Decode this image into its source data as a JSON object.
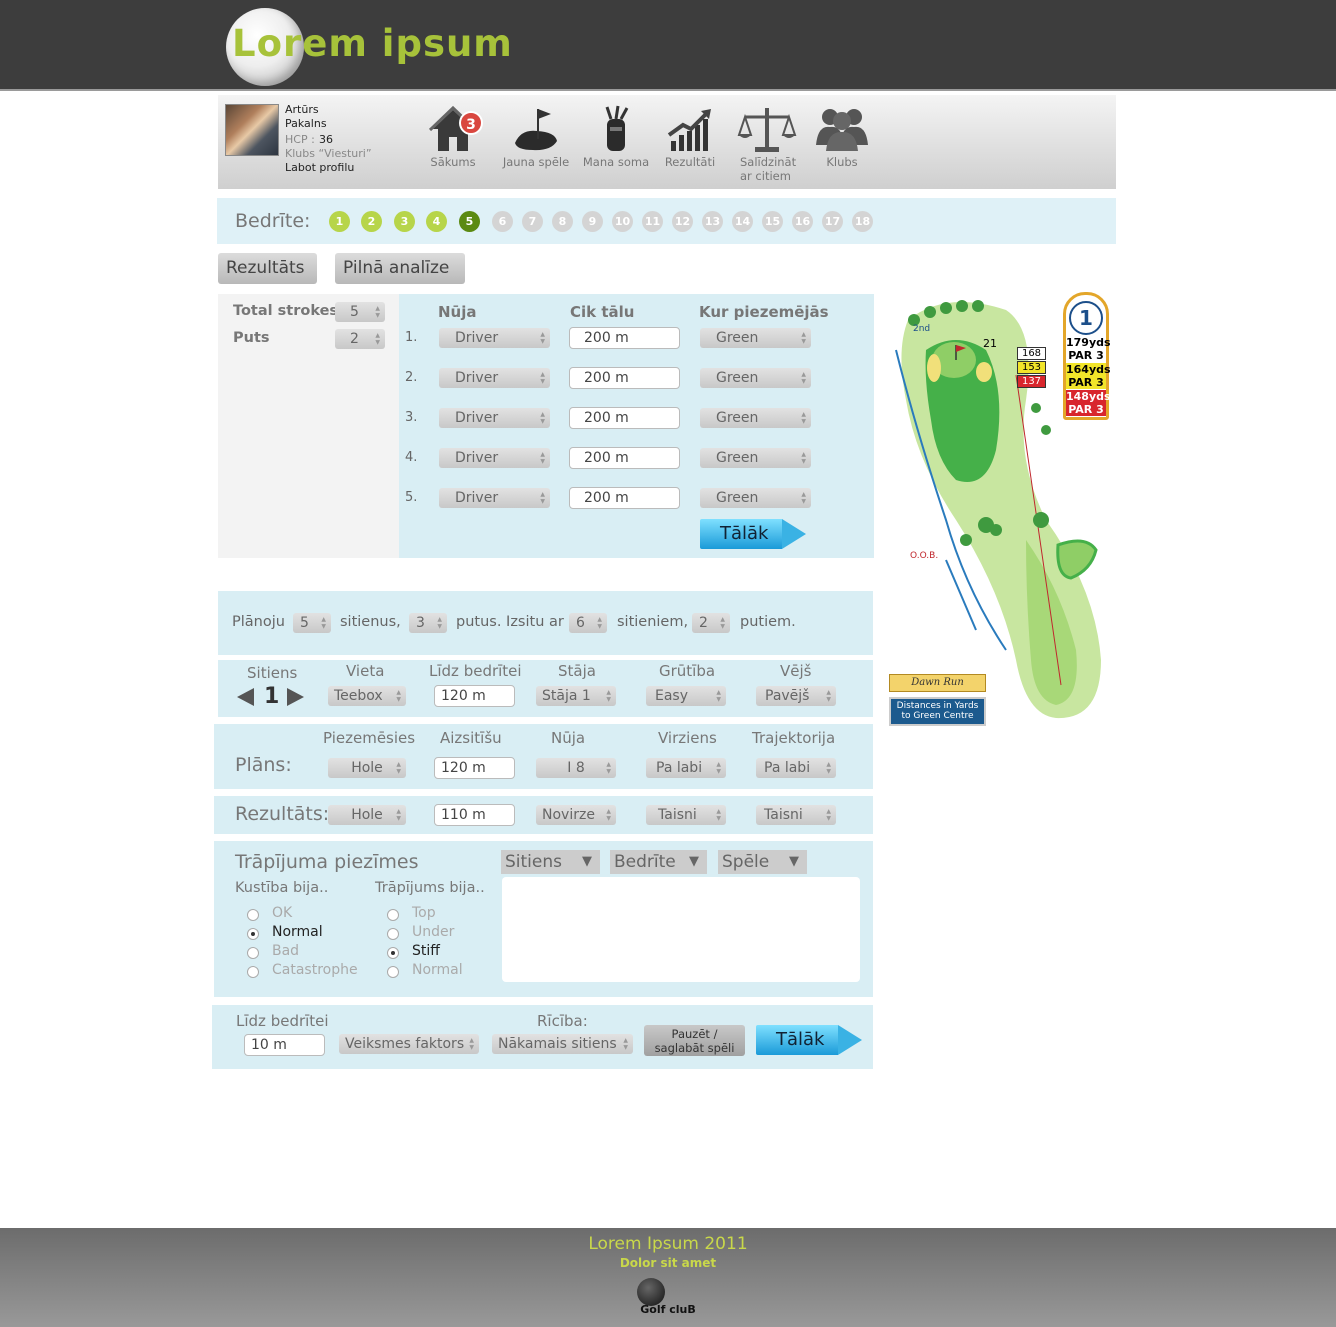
{
  "header": {
    "logo": "Lorem ipsum"
  },
  "user": {
    "first_name": "Artūrs",
    "last_name": "Pakalns",
    "hcp_label": "HCP :",
    "hcp_value": "36",
    "club": "Klubs “Viesturi”",
    "edit_profile": "Labot profilu"
  },
  "nav": {
    "badge": "3",
    "items": [
      {
        "label": "Sākums",
        "icon": "home-icon"
      },
      {
        "label": "Jauna spēle",
        "icon": "golf-green-icon"
      },
      {
        "label": "Mana soma",
        "icon": "golf-bag-icon"
      },
      {
        "label": "Rezultāti",
        "icon": "results-chart-icon"
      },
      {
        "label_1": "Salīdzināt",
        "label_2": "ar citiem",
        "icon": "scales-icon"
      },
      {
        "label": "Klubs",
        "icon": "people-icon"
      }
    ]
  },
  "holes": {
    "label": "Bedrīte:",
    "items": [
      "1",
      "2",
      "3",
      "4",
      "5",
      "6",
      "7",
      "8",
      "9",
      "10",
      "11",
      "12",
      "13",
      "14",
      "15",
      "16",
      "17",
      "18"
    ],
    "current": "5",
    "done": [
      "1",
      "2",
      "3",
      "4"
    ]
  },
  "tabs": {
    "result": "Rezultāts",
    "analysis": "Pilnā analīze"
  },
  "summary": {
    "total_label": "Total strokes",
    "total_value": "5",
    "putts_label": "Puts",
    "putts_value": "2"
  },
  "strokes": {
    "headers": {
      "club": "Nūja",
      "distance": "Cik tālu",
      "landing": "Kur piezemējās"
    },
    "rows": [
      {
        "n": "1.",
        "club": "Driver",
        "distance": "200 m",
        "landing": "Green"
      },
      {
        "n": "2.",
        "club": "Driver",
        "distance": "200 m",
        "landing": "Green"
      },
      {
        "n": "3.",
        "club": "Driver",
        "distance": "200 m",
        "landing": "Green"
      },
      {
        "n": "4.",
        "club": "Driver",
        "distance": "200 m",
        "landing": "Green"
      },
      {
        "n": "5.",
        "club": "Driver",
        "distance": "200 m",
        "landing": "Green"
      }
    ],
    "next": "Tālāk"
  },
  "plan_line": {
    "t1": "Plānoju",
    "v1": "5",
    "t2": "sitienus,",
    "v2": "3",
    "t3": "putus. Izsitu ar",
    "v3": "6",
    "t4": "sitieniem,",
    "v4": "2",
    "t5": "putiem."
  },
  "shot": {
    "headers": {
      "shot": "Sitiens",
      "place": "Vieta",
      "to_hole": "Līdz bedrītei",
      "stance": "Stāja",
      "difficulty": "Grūtība",
      "wind": "Vējš"
    },
    "shot_no": "1",
    "place": "Teebox",
    "to_hole": "120 m",
    "stance": "Stāja 1",
    "difficulty": "Easy",
    "wind": "Pavējš"
  },
  "plan": {
    "label": "Plāns:",
    "headers": {
      "landing": "Piezemēsies",
      "carry": "Aizsitīšu",
      "club": "Nūja",
      "direction": "Virziens",
      "trajectory": "Trajektorija"
    },
    "landing": "Hole",
    "carry": "120 m",
    "club": "I 8",
    "direction": "Pa labi",
    "trajectory": "Pa labi"
  },
  "result": {
    "label": "Rezultāts:",
    "landing": "Hole",
    "carry": "110 m",
    "club": "Novirze",
    "direction": "Taisni",
    "trajectory": "Taisni"
  },
  "notes": {
    "title": "Trāpījuma piezīmes",
    "tabs": [
      "Sitiens",
      "Bedrīte",
      "Spēle"
    ],
    "movement_label": "Kustība bija..",
    "movement": [
      "OK",
      "Normal",
      "Bad",
      "Catastrophe"
    ],
    "movement_selected": "Normal",
    "hit_label": "Trāpījums bija..",
    "hit": [
      "Top",
      "Under",
      "Stiff",
      "Normal"
    ],
    "hit_selected": "Stiff"
  },
  "bottom": {
    "to_hole_label": "Līdz bedrītei",
    "to_hole_value": "10 m",
    "luck": "Veiksmes faktors",
    "action_label": "Rīcība:",
    "action": "Nākamais sitiens",
    "pause_1": "Pauzēt /",
    "pause_2": "saglabāt spēli",
    "next": "Tālāk"
  },
  "map": {
    "hole_no": "1",
    "yds_1": "179yds",
    "par_1": "PAR 3",
    "yds_2": "164yds",
    "par_2": "PAR 3",
    "yds_3": "148yds",
    "par_3": "PAR 3",
    "d1": "168",
    "d2": "153",
    "d3": "137",
    "d_top": "21",
    "second": "2nd",
    "oob": "O.O.B.",
    "legend_1": "Dawn Run",
    "legend_2a": "Distances in Yards",
    "legend_2b": "to Green Centre"
  },
  "footer": {
    "title": "Lorem Ipsum 2011",
    "subtitle": "Dolor sit amet",
    "logo_text": "Golf cluB"
  }
}
